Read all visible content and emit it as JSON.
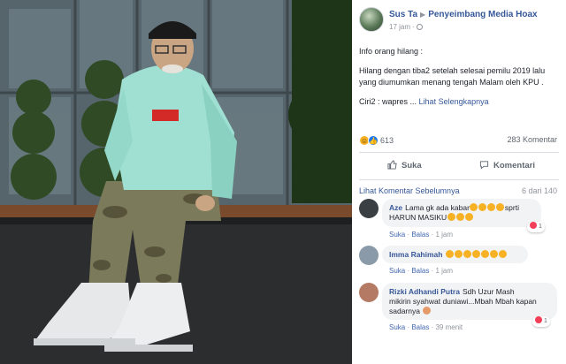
{
  "post": {
    "author": "Sus Ta",
    "group": "Penyeimbang Media Hoax",
    "time": "17 jam",
    "paragraphs": [
      "Info orang hilang :",
      "Hilang dengan tiba2 setelah selesai pemilu 2019 lalu yang diumumkan menang tengah Malam oleh KPU .",
      "Ciri2 : wapres ..."
    ],
    "see_more": "Lihat Selengkapnya",
    "reaction_count": "613",
    "comment_count": "283 Komentar",
    "reaction_icons": [
      "haha-icon",
      "like-icon"
    ],
    "like_label": "Suka",
    "comment_label": "Komentari"
  },
  "comments_section": {
    "previous_label": "Lihat Komentar Sebelumnya",
    "count_label": "6 dari 140",
    "items": [
      {
        "name": "Aze",
        "text_line1": "Lama gk ada kabar",
        "text_line1_end": "sprti",
        "text_line2": "HARUN MASIKU",
        "like": "Suka",
        "reply": "Balas",
        "time": "1 jam",
        "reactions": "1"
      },
      {
        "name": "Imma Rahimah",
        "text_line1": "",
        "like": "Suka",
        "reply": "Balas",
        "time": "1 jam"
      },
      {
        "name": "Rizki Adhandi Putra",
        "text_line1": "Sdh Uzur Mash",
        "text_line2": "mikirin syahwat duniawi...Mbah Mbah kapan",
        "text_line3": "sadarnya",
        "like": "Suka",
        "reply": "Balas",
        "time": "39 menit",
        "reactions": "1"
      }
    ]
  },
  "colors": {
    "link_blue": "#365899",
    "hoodie": "#9fe0d2",
    "reaction_heart": "#f33e58"
  }
}
